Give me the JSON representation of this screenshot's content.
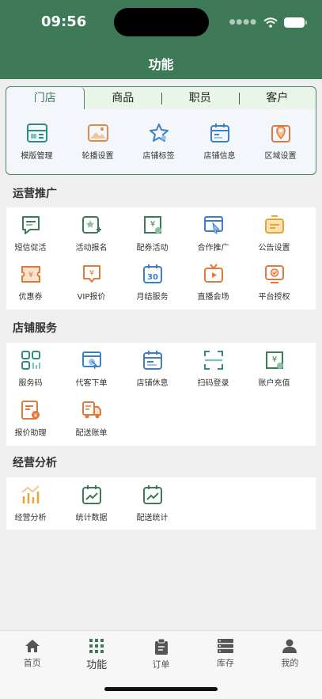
{
  "status_bar": {
    "time": "09:56"
  },
  "header": {
    "title": "功能"
  },
  "store_tabs": [
    "门店",
    "商品",
    "职员",
    "客户"
  ],
  "store_items": [
    {
      "label": "模版管理",
      "icon": "template-icon"
    },
    {
      "label": "轮播设置",
      "icon": "carousel-icon"
    },
    {
      "label": "店铺标签",
      "icon": "tag-star-icon"
    },
    {
      "label": "店铺信息",
      "icon": "calendar-info-icon"
    },
    {
      "label": "区域设置",
      "icon": "map-pin-icon"
    }
  ],
  "sections": [
    {
      "title": "运营推广",
      "items": [
        {
          "label": "短信促活",
          "icon": "sms-icon"
        },
        {
          "label": "活动报名",
          "icon": "activity-signup-icon"
        },
        {
          "label": "配券活动",
          "icon": "coupon-activity-icon"
        },
        {
          "label": "合作推广",
          "icon": "cooperation-icon"
        },
        {
          "label": "公告设置",
          "icon": "announcement-icon"
        },
        {
          "label": "优惠券",
          "icon": "coupon-icon"
        },
        {
          "label": "VIP报价",
          "icon": "vip-price-icon"
        },
        {
          "label": "月结服务",
          "icon": "monthly-icon"
        },
        {
          "label": "直播会场",
          "icon": "live-tv-icon"
        },
        {
          "label": "平台授权",
          "icon": "authorize-icon"
        }
      ]
    },
    {
      "title": "店铺服务",
      "items": [
        {
          "label": "服务码",
          "icon": "service-code-icon"
        },
        {
          "label": "代客下单",
          "icon": "proxy-order-icon"
        },
        {
          "label": "店铺休息",
          "icon": "store-rest-icon"
        },
        {
          "label": "扫码登录",
          "icon": "scan-icon"
        },
        {
          "label": "账户充值",
          "icon": "recharge-icon"
        },
        {
          "label": "报价助理",
          "icon": "quote-assistant-icon"
        },
        {
          "label": "配送账单",
          "icon": "delivery-bill-icon"
        }
      ]
    },
    {
      "title": "经营分析",
      "items": [
        {
          "label": "经营分析",
          "icon": "business-chart-icon"
        },
        {
          "label": "统计数据",
          "icon": "statistics-icon"
        },
        {
          "label": "配送统计",
          "icon": "delivery-stats-icon"
        }
      ]
    }
  ],
  "tabbar": [
    {
      "label": "首页",
      "icon": "home-icon"
    },
    {
      "label": "功能",
      "icon": "grid-icon"
    },
    {
      "label": "订单",
      "icon": "clipboard-icon"
    },
    {
      "label": "库存",
      "icon": "inventory-icon"
    },
    {
      "label": "我的",
      "icon": "user-icon"
    }
  ],
  "colors": {
    "brand_green": "#3e7a57",
    "orange": "#e07a3c",
    "blue": "#3b7fc4",
    "teal": "#2f8a86"
  }
}
